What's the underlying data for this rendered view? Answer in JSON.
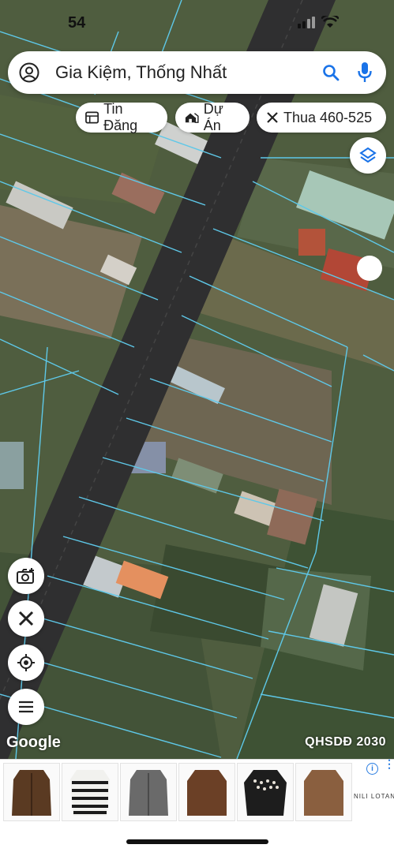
{
  "status_bar": {
    "time": "54"
  },
  "search": {
    "query": "Gia Kiệm, Thống Nhất"
  },
  "chips": [
    {
      "label": "Tin Đăng",
      "icon": "listing-icon"
    },
    {
      "label": "Dự Án",
      "icon": "house-icon"
    },
    {
      "label": "Thua 460-525",
      "icon": "ruler-icon"
    }
  ],
  "map": {
    "attribution": "Google",
    "layer_label": "QHSDĐ 2030",
    "road_color": "#2f2f30",
    "parcel_line_color": "#5ec8e8"
  },
  "ad": {
    "brand": "NILI LOTAN",
    "products": [
      {
        "name": "brown cardigan",
        "color": "#5a3a22"
      },
      {
        "name": "striped knit top",
        "color": "#f1f1ee"
      },
      {
        "name": "grey cardigan",
        "color": "#6a6a6a"
      },
      {
        "name": "brown sweater",
        "color": "#6b4026"
      },
      {
        "name": "patterned sweater",
        "color": "#1d1d1d"
      },
      {
        "name": "camel sweater",
        "color": "#8a5f3f"
      }
    ]
  }
}
